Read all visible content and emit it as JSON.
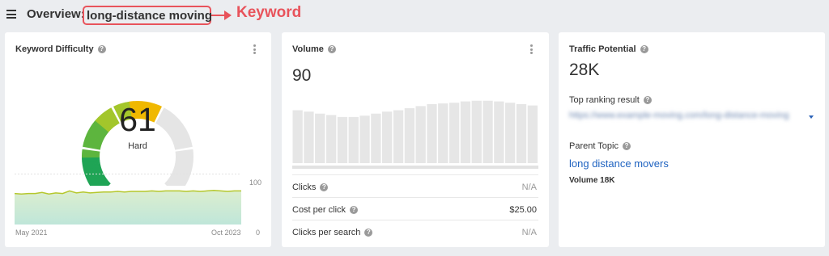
{
  "header": {
    "menu_icon": "hamburger-menu-icon",
    "overview_label": "Overview:",
    "keyword": "long-distance moving",
    "annotation": "Keyword",
    "annotation_color": "#e8535b"
  },
  "keyword_difficulty": {
    "title": "Keyword Difficulty",
    "score": "61",
    "rating": "Hard",
    "gauge_fill_fraction": 0.61,
    "gauge_colors": [
      "#1fa455",
      "#5db53e",
      "#a3c62b",
      "#f0b800",
      "#e5e5e5"
    ],
    "trend_y_max": "100",
    "trend_y_min": "0",
    "trend_start": "May 2021",
    "trend_end": "Oct 2023",
    "trend_line_color": "#b5c72d",
    "trend_values": [
      61,
      60,
      61,
      61,
      63,
      60,
      62,
      61,
      66,
      62,
      64,
      62,
      63,
      64,
      64,
      65,
      64,
      65,
      65,
      65,
      66,
      65,
      66,
      66,
      66,
      65,
      66,
      65,
      66,
      67,
      66,
      65,
      66,
      66
    ]
  },
  "volume": {
    "title": "Volume",
    "value": "90",
    "bar_values": [
      78,
      76,
      73,
      71,
      68,
      68,
      70,
      73,
      76,
      78,
      81,
      84,
      87,
      88,
      89,
      91,
      92,
      92,
      91,
      89,
      87,
      85
    ],
    "rows": [
      {
        "label": "Clicks",
        "value": "N/A"
      },
      {
        "label": "Cost per click",
        "value": "$25.00"
      },
      {
        "label": "Clicks per search",
        "value": "N/A"
      }
    ]
  },
  "traffic_potential": {
    "title": "Traffic Potential",
    "value": "28K",
    "top_result_label": "Top ranking result",
    "top_result_url": "https://www.example-moving.com/long-distance-moving",
    "parent_topic_label": "Parent Topic",
    "parent_topic": "long distance movers",
    "parent_volume": "Volume 18K"
  }
}
